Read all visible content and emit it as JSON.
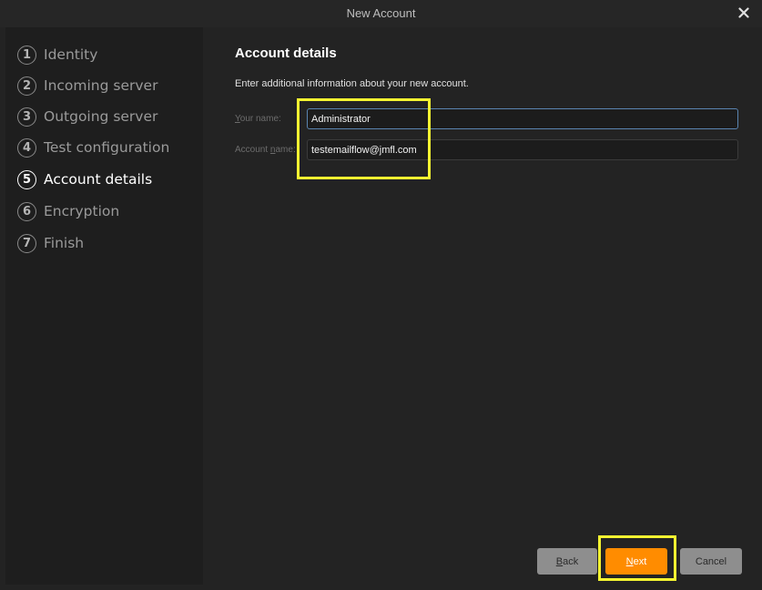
{
  "window": {
    "title": "New Account"
  },
  "steps": [
    {
      "number": "1",
      "label": "Identity"
    },
    {
      "number": "2",
      "label": "Incoming server"
    },
    {
      "number": "3",
      "label": "Outgoing server"
    },
    {
      "number": "4",
      "label": "Test configuration"
    },
    {
      "number": "5",
      "label": "Account details",
      "active": true
    },
    {
      "number": "6",
      "label": "Encryption"
    },
    {
      "number": "7",
      "label": "Finish"
    }
  ],
  "main": {
    "heading": "Account details",
    "subtitle": "Enter additional information about your new account.",
    "fields": {
      "your_name": {
        "label_prefix": "",
        "label_mnemonic": "Y",
        "label_rest": "our name:",
        "value": "Administrator"
      },
      "account_name": {
        "label_prefix": "Account ",
        "label_mnemonic": "n",
        "label_rest": "ame:",
        "value": "testemailflow@jmfl.com"
      }
    }
  },
  "buttons": {
    "back": {
      "mnemonic": "B",
      "rest": "ack"
    },
    "next": {
      "mnemonic": "N",
      "rest": "ext"
    },
    "cancel": {
      "label": "Cancel"
    }
  },
  "colors": {
    "accent": "#ff8c00",
    "highlight": "#f5f531"
  },
  "icons": {
    "close": "close-icon"
  }
}
